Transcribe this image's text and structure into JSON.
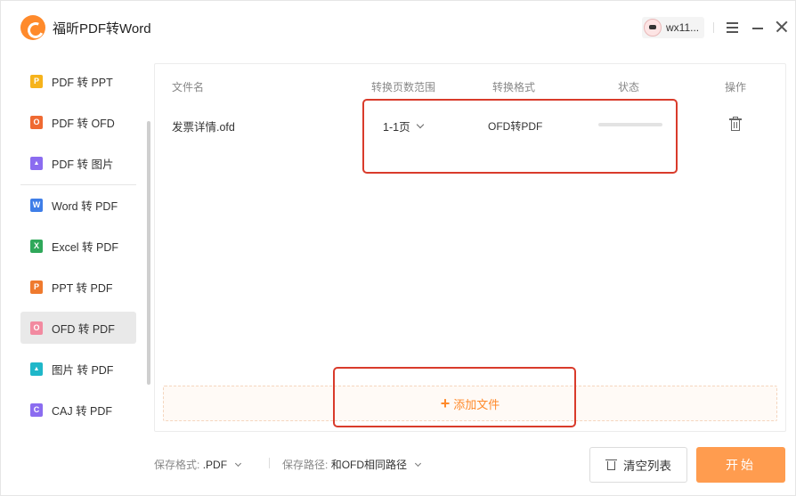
{
  "app": {
    "title": "福昕PDF转Word",
    "user_name": "wx11..."
  },
  "colors": {
    "accent": "#ff8a2b",
    "start_button": "#ff9c4f",
    "annotation_red": "#d93b2b"
  },
  "sidebar": {
    "items": [
      {
        "label": "PDF 转 PPT",
        "icon": "ppt-icon",
        "icon_color": "#f6b31b",
        "glyph": "P"
      },
      {
        "label": "PDF 转 OFD",
        "icon": "ofd-icon",
        "icon_color": "#ef6a32",
        "glyph": "O"
      },
      {
        "label": "PDF 转 图片",
        "icon": "image-icon",
        "icon_color": "#8b6cf0",
        "glyph": "▲"
      },
      {
        "label": "Word 转 PDF",
        "icon": "word-icon",
        "icon_color": "#3f7ee8",
        "glyph": "W"
      },
      {
        "label": "Excel 转 PDF",
        "icon": "excel-icon",
        "icon_color": "#2fa85a",
        "glyph": "X"
      },
      {
        "label": "PPT 转 PDF",
        "icon": "ppt-icon",
        "icon_color": "#ef7a2e",
        "glyph": "P"
      },
      {
        "label": "OFD 转 PDF",
        "icon": "ofd-icon",
        "icon_color": "#f28aa0",
        "glyph": "O",
        "active": true
      },
      {
        "label": "图片 转 PDF",
        "icon": "image-icon",
        "icon_color": "#1fb7c9",
        "glyph": "▲"
      },
      {
        "label": "CAJ 转 PDF",
        "icon": "caj-icon",
        "icon_color": "#8b6cf0",
        "glyph": "C"
      }
    ]
  },
  "table": {
    "headers": {
      "filename": "文件名",
      "page_range": "转换页数范围",
      "format": "转换格式",
      "status": "状态",
      "action": "操作"
    },
    "rows": [
      {
        "filename": "发票详情.ofd",
        "page_range": "1-1页",
        "format": "OFD转PDF",
        "progress": 0
      }
    ]
  },
  "add_file": {
    "label": "添加文件"
  },
  "footer": {
    "save_format_label": "保存格式:",
    "save_format_value": ".PDF",
    "save_path_label": "保存路径:",
    "save_path_value": "和OFD相同路径",
    "clear_label": "清空列表",
    "start_label": "开始"
  }
}
